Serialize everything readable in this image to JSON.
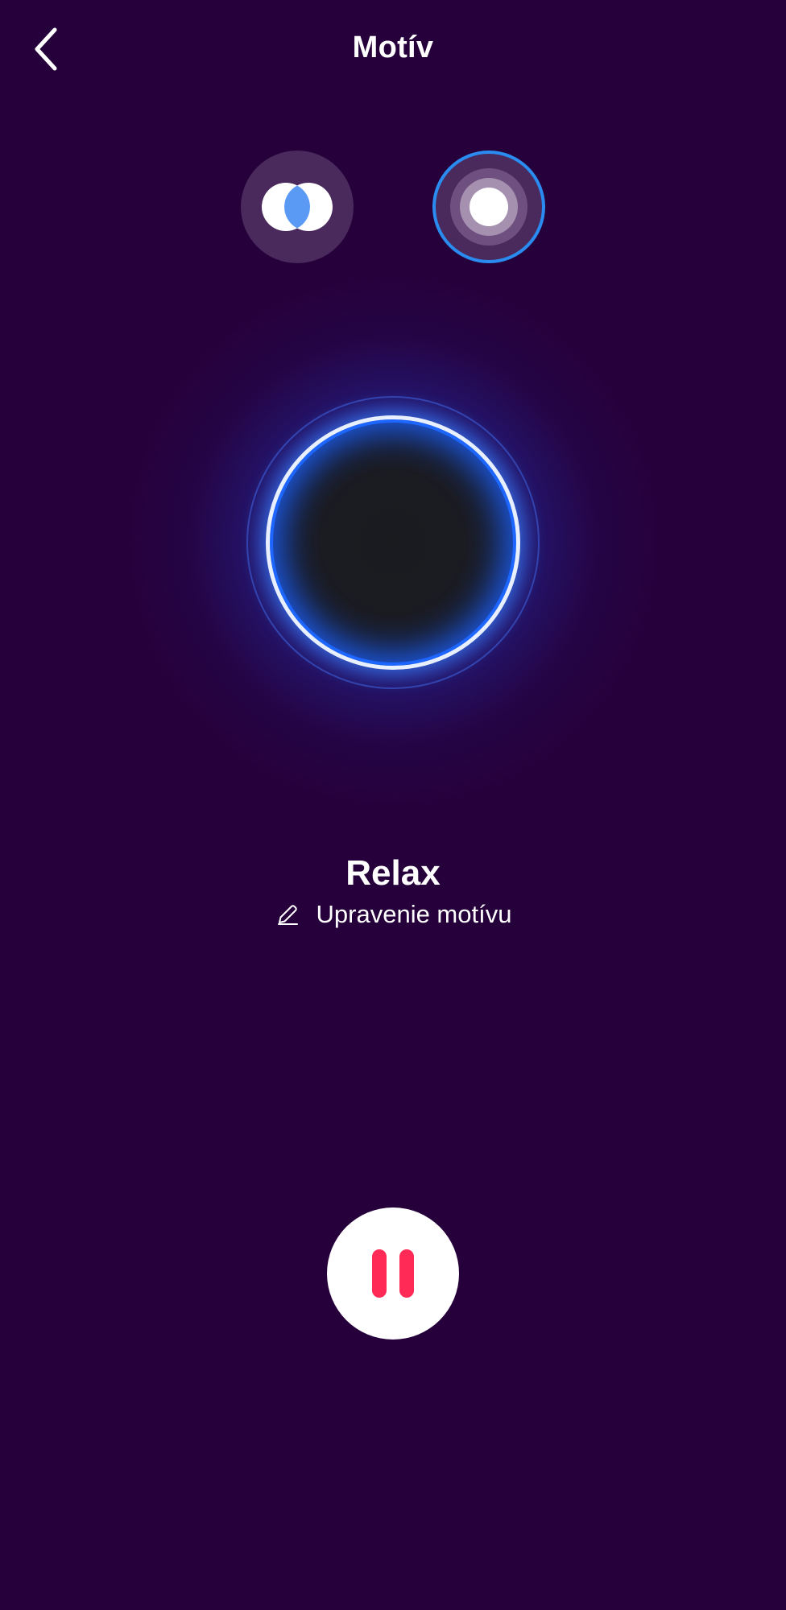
{
  "header": {
    "title": "Motív",
    "back_icon": "chevron-left-icon"
  },
  "modes": [
    {
      "name": "dual-circle-mode",
      "icon": "overlapping-circles-icon",
      "selected": false
    },
    {
      "name": "pulse-mode",
      "icon": "concentric-circles-icon",
      "selected": true
    }
  ],
  "theme": {
    "name": "Relax",
    "edit_label": "Upravenie motívu",
    "edit_icon": "pencil-icon"
  },
  "playback": {
    "icon": "pause-icon",
    "state": "playing"
  },
  "colors": {
    "background": "#26003a",
    "accent_blue": "#2a8cf0",
    "pause_red": "#ff2a55",
    "text": "#ffffff"
  }
}
